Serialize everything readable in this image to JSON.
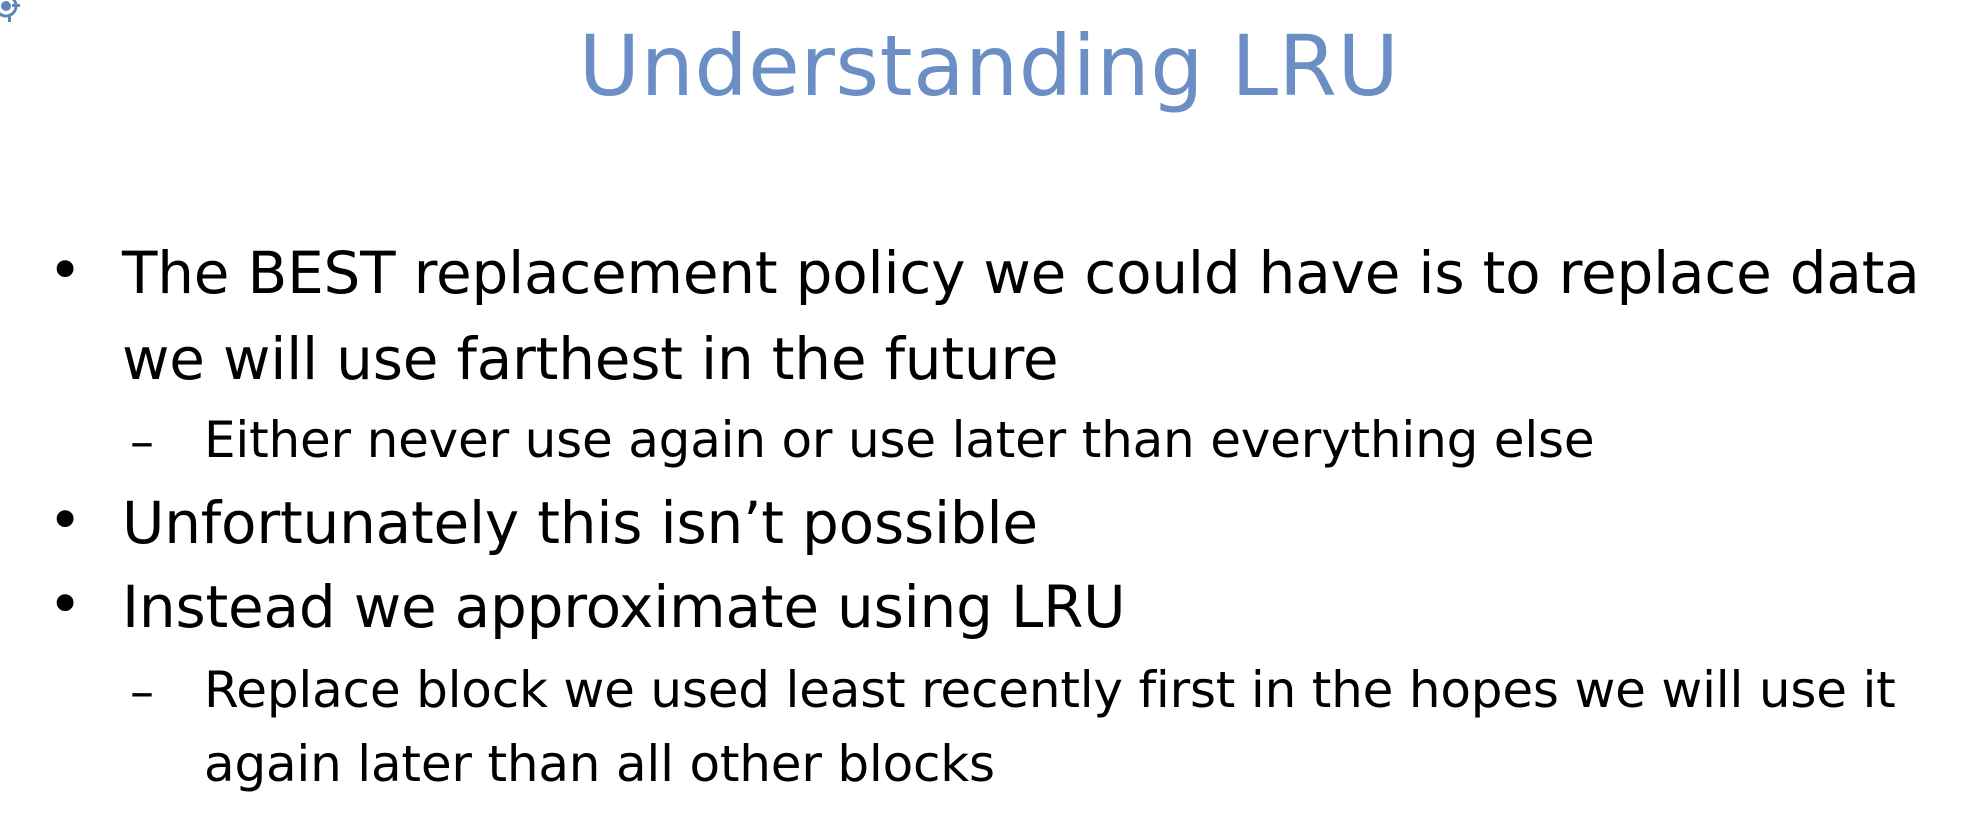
{
  "slide": {
    "title": "Understanding LRU",
    "bullets": [
      {
        "lines": [
          "The BEST replacement policy we could have is to replace data",
          "we will use farthest in the future"
        ],
        "subs": [
          {
            "lines": [
              "Either never use again or use later than everything else"
            ]
          }
        ]
      },
      {
        "lines": [
          "Unfortunately this isn’t possible"
        ],
        "subs": []
      },
      {
        "lines": [
          "Instead we approximate using LRU"
        ],
        "subs": [
          {
            "lines": [
              "Replace block we used least recently first in the hopes we will use it",
              "again later than all other blocks"
            ]
          }
        ]
      }
    ],
    "bullet_glyph": "•",
    "sub_glyph": "–",
    "colors": {
      "title": "#6b8fc4",
      "text": "#000000",
      "background": "#ffffff"
    },
    "icons": [
      "gear-logo-icon"
    ]
  }
}
